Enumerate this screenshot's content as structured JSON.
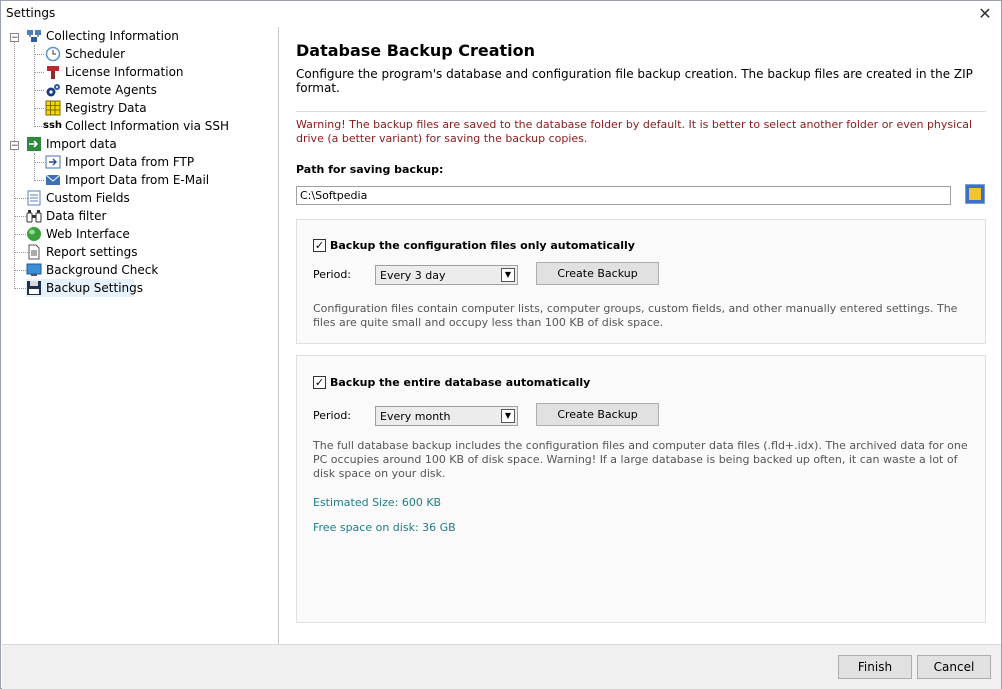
{
  "window": {
    "title": "Settings",
    "close_glyph": "✕"
  },
  "sidebar": {
    "items": [
      {
        "label": "Collecting Information",
        "icon": "collect-info-icon",
        "expander": "−"
      },
      {
        "label": "Scheduler",
        "icon": "clock-icon"
      },
      {
        "label": "License Information",
        "icon": "license-icon"
      },
      {
        "label": "Remote Agents",
        "icon": "agents-gear-icon"
      },
      {
        "label": "Registry Data",
        "icon": "registry-grid-icon"
      },
      {
        "label": "Collect Information via SSH",
        "icon": "ssh-icon",
        "icon_text": "ssh"
      },
      {
        "label": "Import data",
        "icon": "import-icon",
        "expander": "−"
      },
      {
        "label": "Import Data from FTP",
        "icon": "ftp-import-icon"
      },
      {
        "label": "Import Data from E-Mail",
        "icon": "email-import-icon"
      },
      {
        "label": "Custom Fields",
        "icon": "custom-fields-icon"
      },
      {
        "label": "Data filter",
        "icon": "binoculars-icon"
      },
      {
        "label": "Web Interface",
        "icon": "globe-icon"
      },
      {
        "label": "Report settings",
        "icon": "report-icon"
      },
      {
        "label": "Background Check",
        "icon": "monitor-icon"
      },
      {
        "label": "Backup Settings",
        "icon": "floppy-disk-icon"
      }
    ]
  },
  "main": {
    "title": "Database Backup Creation",
    "intro": "Configure the program's database and configuration file backup creation. The backup files are created in the ZIP format.",
    "warning": "Warning! The backup files are saved to the database folder by default. It is better to select another folder or even physical drive (a better variant) for saving the backup copies.",
    "path_label": "Path for saving backup:",
    "path_value": "C:\\Softpedia",
    "config_backup": {
      "checkbox_label": "Backup the configuration files only automatically",
      "checked": true,
      "check_glyph": "✓",
      "period_label": "Period:",
      "period_value": "Every 3 day",
      "button_label": "Create Backup",
      "description": "Configuration files contain computer lists, computer groups, custom fields, and other manually entered settings. The files are quite small and occupy less than 100 KB of disk space."
    },
    "db_backup": {
      "checkbox_label": "Backup the entire database automatically",
      "checked": true,
      "check_glyph": "✓",
      "period_label": "Period:",
      "period_value": "Every month",
      "button_label": "Create Backup",
      "description": "The full database backup includes the configuration files and computer data files (.fld+.idx). The archived data for one PC occupies around 100 KB of disk space. Warning! If a large database is being backed up often, it can waste a lot of disk space on your disk.",
      "estimated_size": "Estimated Size: 600 KB",
      "free_space": "Free space on disk: 36 GB"
    },
    "dropdown_arrow": "▼"
  },
  "footer": {
    "finish_label": "Finish",
    "cancel_label": "Cancel"
  },
  "colors": {
    "warning": "#8b1a1a",
    "info": "#1d7e86",
    "selected_bg": "#e5f1fb"
  }
}
